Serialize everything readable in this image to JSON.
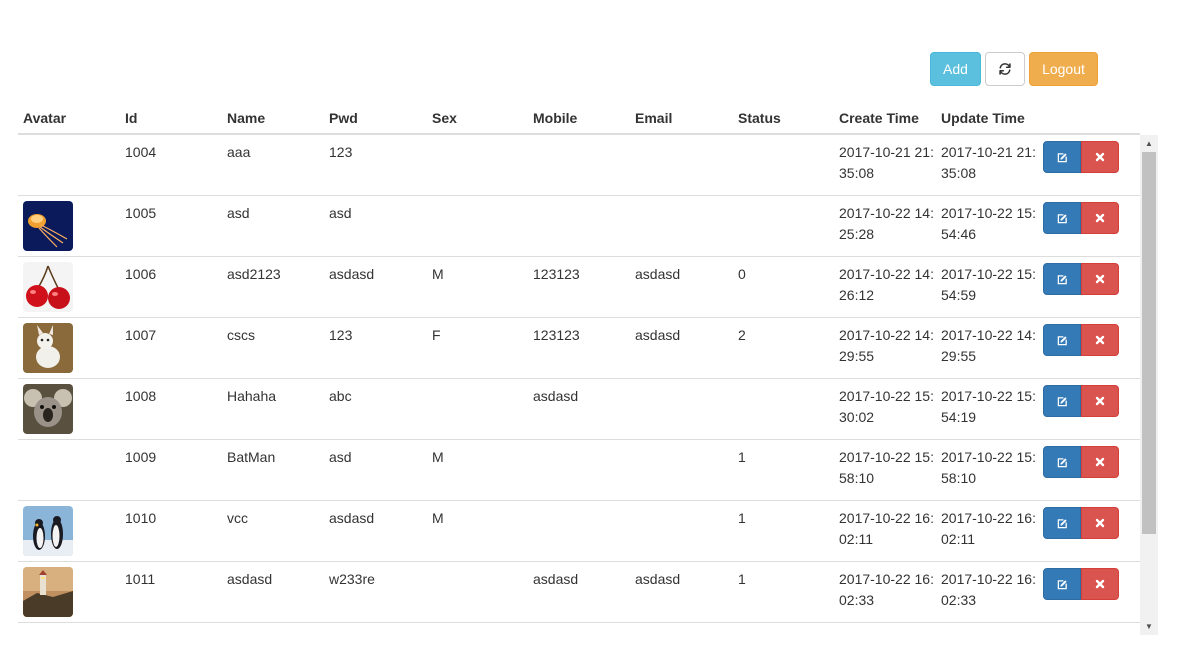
{
  "toolbar": {
    "add_label": "Add",
    "refresh_icon": "refresh-icon",
    "logout_label": "Logout"
  },
  "table": {
    "headers": [
      "Avatar",
      "Id",
      "Name",
      "Pwd",
      "Sex",
      "Mobile",
      "Email",
      "Status",
      "Create Time",
      "Update Time"
    ],
    "rows": [
      {
        "avatar": "",
        "id": "1004",
        "name": "aaa",
        "pwd": "123",
        "sex": "",
        "mobile": "",
        "email": "",
        "status": "",
        "create": "2017-10-21 21:35:08",
        "update": "2017-10-21 21:35:08"
      },
      {
        "avatar": "jellyfish",
        "id": "1005",
        "name": "asd",
        "pwd": "asd",
        "sex": "",
        "mobile": "",
        "email": "",
        "status": "",
        "create": "2017-10-22 14:25:28",
        "update": "2017-10-22 15:54:46"
      },
      {
        "avatar": "cherries",
        "id": "1006",
        "name": "asd2123",
        "pwd": "asdasd",
        "sex": "M",
        "mobile": "123123",
        "email": "asdasd",
        "status": "0",
        "create": "2017-10-22 14:26:12",
        "update": "2017-10-22 15:54:59"
      },
      {
        "avatar": "dog",
        "id": "1007",
        "name": "cscs",
        "pwd": "123",
        "sex": "F",
        "mobile": "123123",
        "email": "asdasd",
        "status": "2",
        "create": "2017-10-22 14:29:55",
        "update": "2017-10-22 14:29:55"
      },
      {
        "avatar": "koala",
        "id": "1008",
        "name": "Hahaha",
        "pwd": "abc",
        "sex": "",
        "mobile": "asdasd",
        "email": "",
        "status": "",
        "create": "2017-10-22 15:30:02",
        "update": "2017-10-22 15:54:19"
      },
      {
        "avatar": "",
        "id": "1009",
        "name": "BatMan",
        "pwd": "asd",
        "sex": "M",
        "mobile": "",
        "email": "",
        "status": "1",
        "create": "2017-10-22 15:58:10",
        "update": "2017-10-22 15:58:10"
      },
      {
        "avatar": "penguins",
        "id": "1010",
        "name": "vcc",
        "pwd": "asdasd",
        "sex": "M",
        "mobile": "",
        "email": "",
        "status": "1",
        "create": "2017-10-22 16:02:11",
        "update": "2017-10-22 16:02:11"
      },
      {
        "avatar": "lighthouse",
        "id": "1011",
        "name": "asdasd",
        "pwd": "w233re",
        "sex": "",
        "mobile": "asdasd",
        "email": "asdasd",
        "status": "1",
        "create": "2017-10-22 16:02:33",
        "update": "2017-10-22 16:02:33"
      }
    ]
  },
  "actions": {
    "edit_icon": "edit-icon",
    "delete_icon": "delete-icon"
  },
  "colors": {
    "add": "#5bc0de",
    "logout": "#f0ad4e",
    "edit": "#337ab7",
    "delete": "#d9534f"
  }
}
